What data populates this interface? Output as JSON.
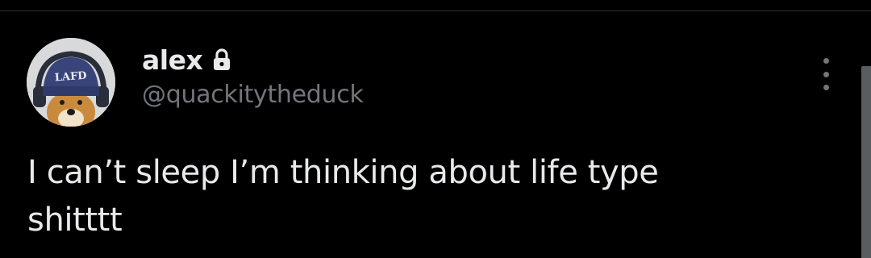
{
  "tweet": {
    "author": {
      "display_name": "alex",
      "handle": "@quackitytheduck",
      "protected": true,
      "avatar_icon": "dog-with-lafd-beanie-avatar",
      "avatar_beanie_text": "LAFD"
    },
    "text_line_1": "I can’t sleep I’m thinking about life type",
    "text_line_2": "shitttt",
    "more_icon": "vertical-ellipsis-icon",
    "lock_icon": "lock-icon"
  },
  "colors": {
    "background": "#000000",
    "primary_text": "#e7e9ea",
    "secondary_text": "#71767b",
    "divider": "#2f3336"
  }
}
